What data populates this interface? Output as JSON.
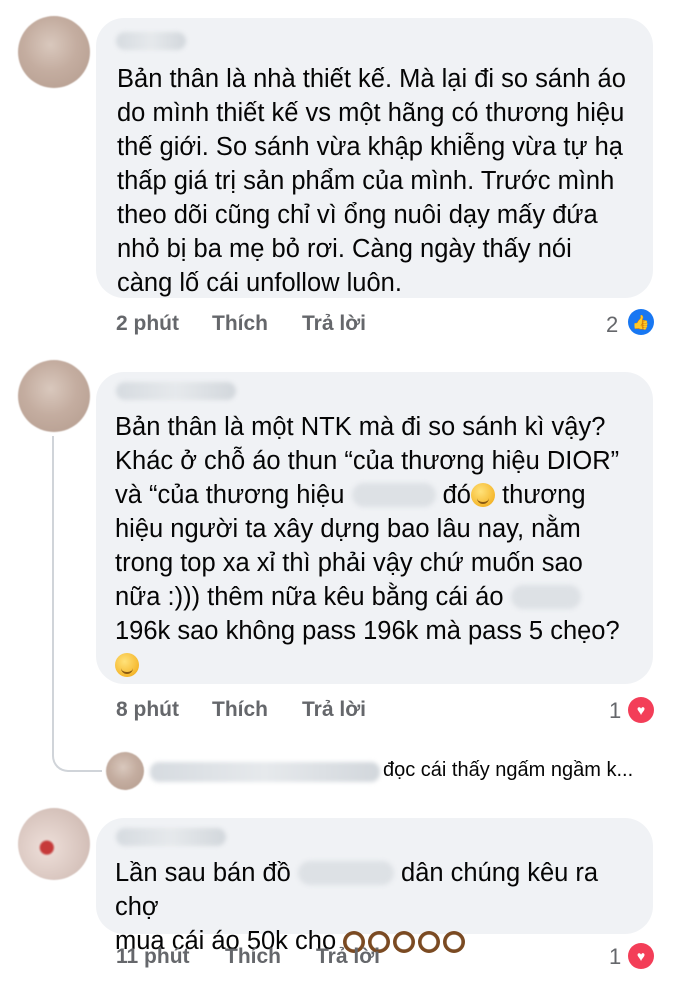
{
  "comments": [
    {
      "text": "Bản thân là nhà thiết kế. Mà lại đi so sánh áo\ndo mình thiết kế vs một hãng có thương hiệu\nthế giới. So sánh vừa khập khiễng vừa tự hạ\nthấp giá trị sản phẩm của mình. Trước mình\ntheo dõi cũng chỉ vì ổng nuôi dạy mấy đứa\nnhỏ bị ba mẹ bỏ rơi. Càng ngày thấy nói\ncàng lố cái unfollow luôn.",
      "time": "2 phút",
      "like": "Thích",
      "reply": "Trả lời",
      "reaction_count": "2",
      "reaction_icon": "like-icon"
    },
    {
      "line1": "Bản thân là một NTK mà đi so sánh kì vậy?",
      "line2": "Khác ở chỗ áo thun “của thương hiệu DIOR”",
      "line3a": "và “của thương hiệu",
      "line3b": "đó",
      "line3c": " thương",
      "line4": "hiệu người ta xây dựng bao lâu nay, nằm",
      "line5": "trong top xa xỉ thì phải vậy chứ muốn sao",
      "line6": "nữa :))) thêm nữa kêu bằng cái áo",
      "line7": "196k sao không pass 196k mà pass 5 chẹo?",
      "time": "8 phút",
      "like": "Thích",
      "reply": "Trả lời",
      "reaction_count": "1",
      "reaction_icon": "heart-icon"
    },
    {
      "reply_preview": "đọc cái thấy ngấm ngầm k..."
    },
    {
      "line1a": "Lần sau bán đồ",
      "line1b": "dân chúng kêu ra chợ",
      "line2": "mua cái áo 50k cho",
      "time": "11 phút",
      "like": "Thích",
      "reply": "Trả lời",
      "reaction_count": "1",
      "reaction_icon": "heart-icon"
    }
  ],
  "colors": {
    "bubble": "#f0f2f5",
    "meta_text": "#65676b",
    "like_blue": "#1877f2",
    "heart_red": "#f33e58"
  }
}
